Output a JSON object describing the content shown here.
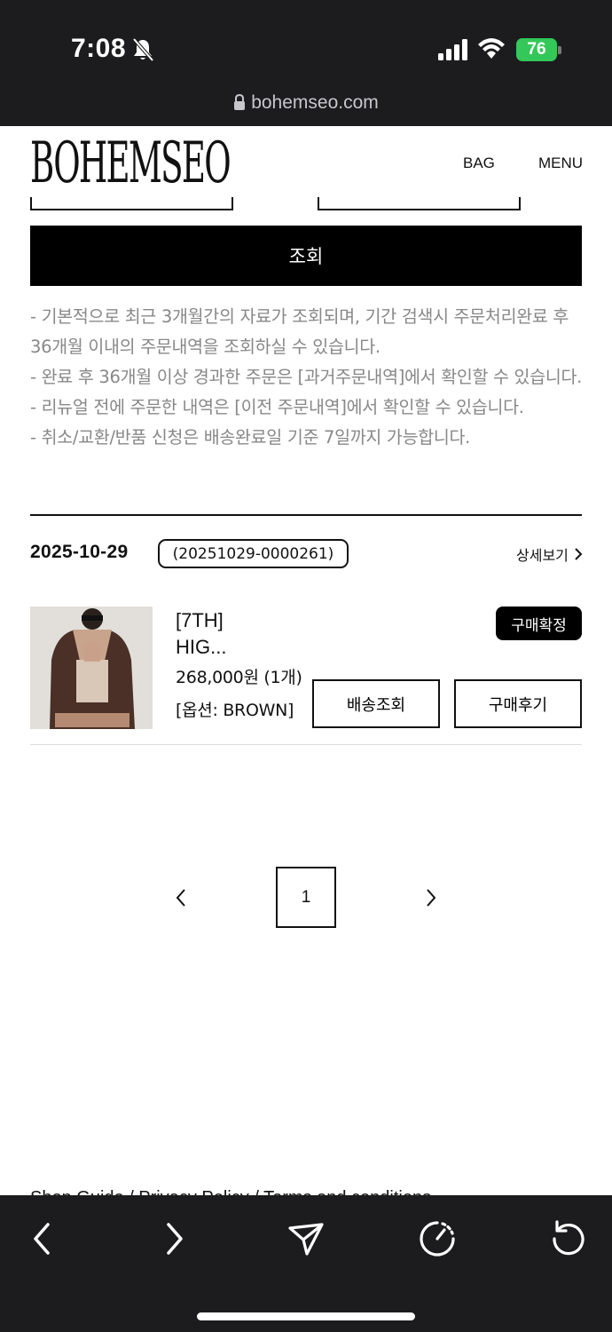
{
  "status_bar": {
    "time": "7:08",
    "battery": "76",
    "url": "bohemseo.com"
  },
  "header": {
    "logo": "BOHEMSEO",
    "nav_bag": "BAG",
    "nav_menu": "MENU"
  },
  "search": {
    "button_label": "조회"
  },
  "notice": [
    "- 기본적으로 최근 3개월간의 자료가 조회되며, 기간 검색시 주문처리완료 후 36개월 이내의 주문내역을 조회하실 수 있습니다.",
    "- 완료 후 36개월 이상 경과한 주문은 [과거주문내역]에서 확인할 수 있습니다.",
    "- 리뉴얼 전에 주문한 내역은 [이전 주문내역]에서 확인할 수 있습니다.",
    "- 취소/교환/반품 신청은 배송완료일 기준 7일까지 가능합니다."
  ],
  "order": {
    "date": "2025-10-29",
    "number": "(20251029-0000261)",
    "detail_link": "상세보기",
    "item": {
      "name_line1": "[7TH]",
      "name_line2": "HIG...",
      "price": "268,000원 (1개)",
      "option": "[옵션: BROWN]",
      "status": "구매확정",
      "track_button": "배송조회",
      "review_button": "구매후기"
    }
  },
  "pagination": {
    "current": "1"
  },
  "footer_peek": "Shop Guide  /  Privacy Policy  /  Terms and conditions",
  "colors": {
    "toolbar_bg": "#1c1c1e",
    "battery_green": "#34c759",
    "notice_text": "#888888"
  }
}
